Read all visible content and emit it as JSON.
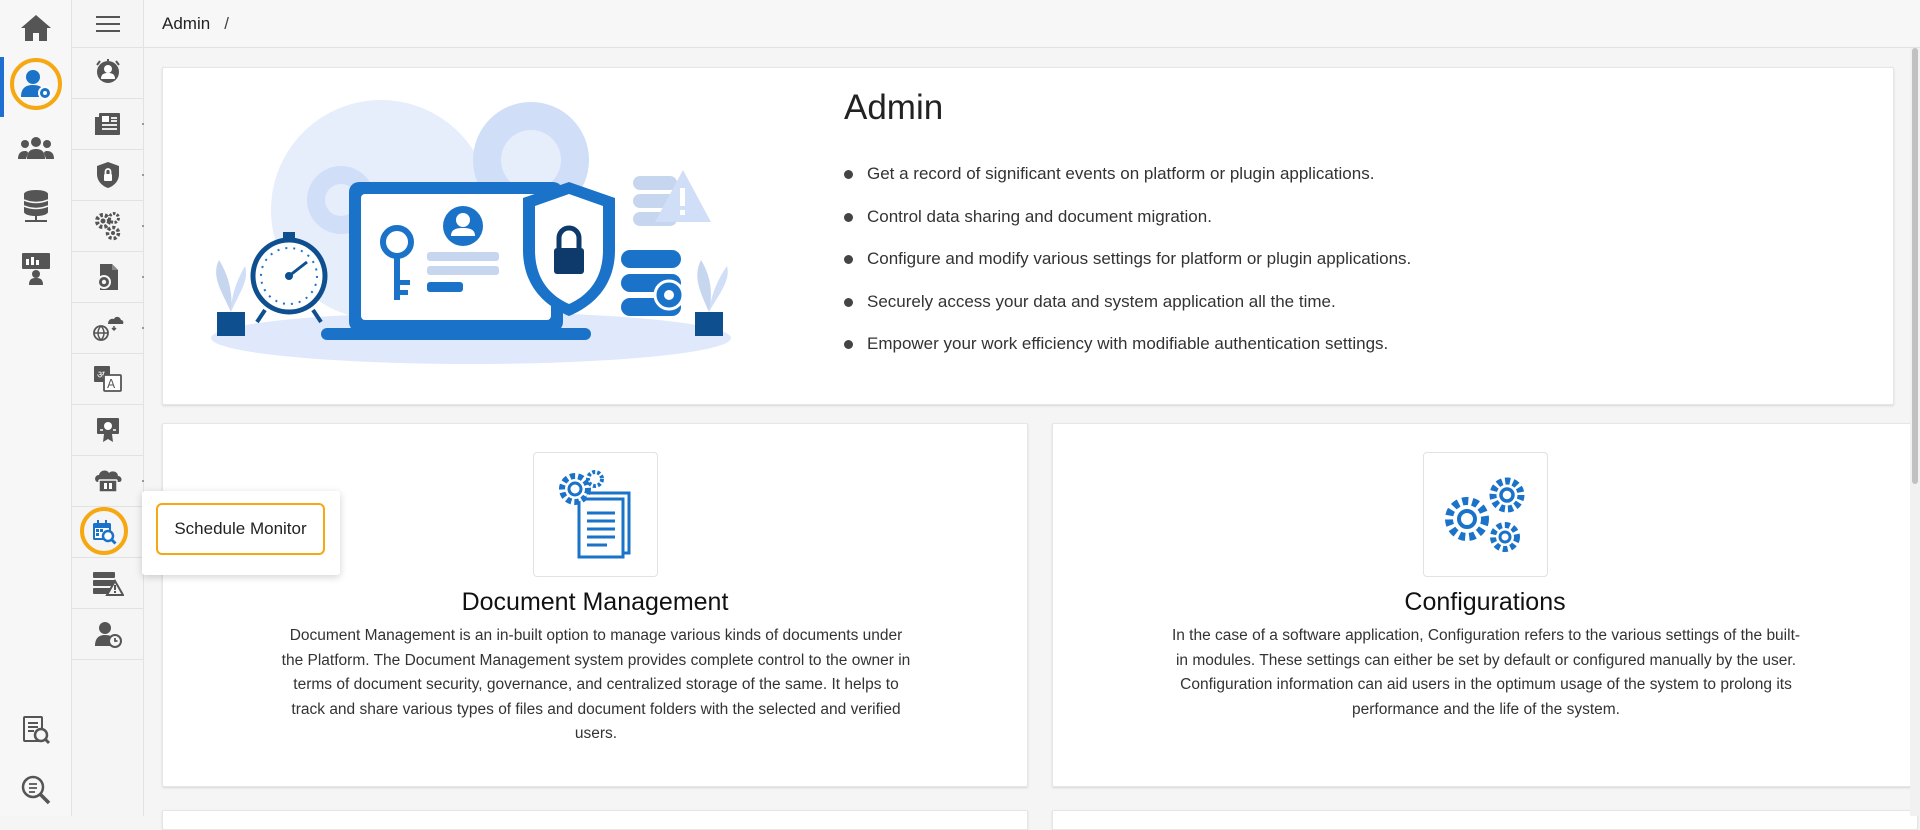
{
  "breadcrumb": {
    "current": "Admin",
    "separator": "/"
  },
  "rail": {
    "items": [
      {
        "name": "home-icon"
      },
      {
        "name": "admin-user-gear-icon",
        "active": true
      },
      {
        "name": "users-group-icon"
      },
      {
        "name": "database-icon"
      },
      {
        "name": "presentation-icon"
      }
    ],
    "bottom_items": [
      {
        "name": "report-search-icon"
      },
      {
        "name": "data-search-icon"
      }
    ]
  },
  "submenu": {
    "items": [
      {
        "name": "user-badge-icon"
      },
      {
        "name": "audit-document-icon"
      },
      {
        "name": "shield-lock-icon"
      },
      {
        "name": "gears-icon"
      },
      {
        "name": "document-gear-icon"
      },
      {
        "name": "globe-cloud-icon"
      },
      {
        "name": "translate-icon"
      },
      {
        "name": "certificate-icon"
      },
      {
        "name": "cloud-server-icon"
      },
      {
        "name": "schedule-monitor-icon",
        "highlighted": true
      },
      {
        "name": "server-warning-icon"
      },
      {
        "name": "user-clock-icon"
      }
    ]
  },
  "tooltip": {
    "label": "Schedule Monitor"
  },
  "hero": {
    "title": "Admin",
    "bullets": [
      "Get a record of significant events on platform or plugin applications.",
      "Control data sharing and document migration.",
      "Configure and modify various settings for platform or plugin applications.",
      "Securely access your data and system application all the time.",
      "Empower your work efficiency with modifiable authentication settings."
    ]
  },
  "cards": {
    "document_management": {
      "title": "Document Management",
      "description": "Document Management is an in-built option to manage various kinds of documents under the Platform. The Document Management system provides complete control to the owner in terms of document security, governance, and centralized storage of the same. It helps to track and share various types of files and document folders with the selected and verified users."
    },
    "configurations": {
      "title": "Configurations",
      "description": "In the case of a software application, Configuration refers to the various settings of the built-in modules. These settings can either be set by default or configured manually by the user. Configuration information can aid users in the optimum usage of the system to prolong its performance and the life of the system."
    }
  },
  "colors": {
    "accent": "#1f6fd0",
    "highlight": "#f5a812",
    "icon_gray": "#555555",
    "icon_blue": "#1a73c9"
  }
}
